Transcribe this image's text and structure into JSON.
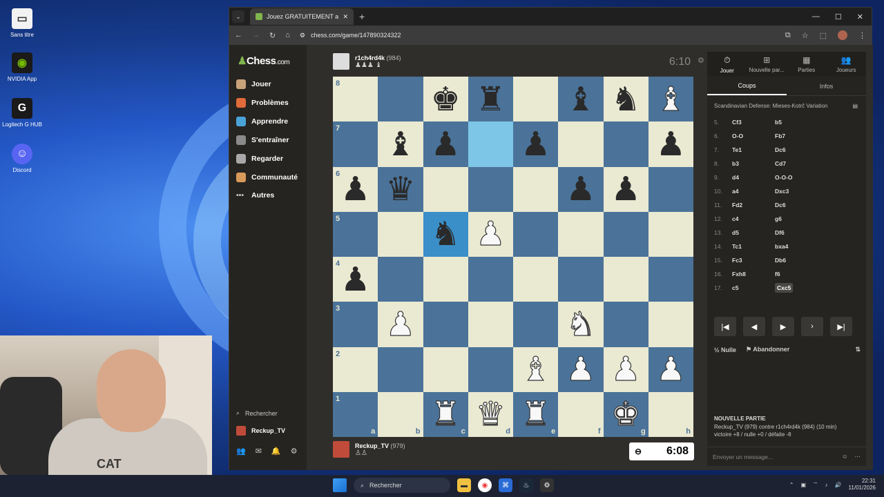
{
  "desktop": {
    "icons": [
      {
        "label": "Sans titre"
      },
      {
        "label": "NVIDIA App"
      },
      {
        "label": "Logitech G HUB"
      },
      {
        "label": "Discord"
      }
    ]
  },
  "browser": {
    "tab_title": "Jouez GRATUITEMENT aux éch",
    "url": "chess.com/game/147890324322"
  },
  "sidenav": {
    "logo": "Chess",
    "logo_suffix": ".com",
    "items": [
      {
        "label": "Jouer"
      },
      {
        "label": "Problèmes"
      },
      {
        "label": "Apprendre"
      },
      {
        "label": "S'entraîner"
      },
      {
        "label": "Regarder"
      },
      {
        "label": "Communauté"
      },
      {
        "label": "Autres"
      }
    ],
    "search": "Rechercher",
    "user": "Reckup_TV"
  },
  "game": {
    "top_player": {
      "name": "r1ch4rd4k",
      "rating": "(984)",
      "captured": "♟♟♟ ♝"
    },
    "top_clock": "6:10",
    "bottom_player": {
      "name": "Reckup_TV",
      "rating": "(979)",
      "captured": "♙♙"
    },
    "bottom_clock": "6:08",
    "board": [
      [
        "",
        "",
        "bK",
        "bR",
        "",
        "bB",
        "bN",
        "wB"
      ],
      [
        "",
        "bB",
        "bP",
        "",
        "bP",
        "",
        "",
        "bP"
      ],
      [
        "bP",
        "bQ",
        "",
        "",
        "",
        "bP",
        "bP",
        ""
      ],
      [
        "",
        "",
        "bN",
        "wP",
        "",
        "",
        "",
        ""
      ],
      [
        "bP",
        "",
        "",
        "",
        "",
        "",
        "",
        ""
      ],
      [
        "",
        "wP",
        "",
        "",
        "",
        "wN",
        "",
        ""
      ],
      [
        "",
        "",
        "",
        "",
        "wB",
        "wP",
        "wP",
        "wP"
      ],
      [
        "",
        "",
        "wR",
        "wQ",
        "wR",
        "",
        "wK",
        ""
      ]
    ],
    "highlight": [
      [
        1,
        3
      ],
      [
        3,
        2
      ]
    ],
    "ranks": [
      "8",
      "7",
      "6",
      "5",
      "4",
      "3",
      "2",
      "1"
    ],
    "files": [
      "a",
      "b",
      "c",
      "d",
      "e",
      "f",
      "g",
      "h"
    ]
  },
  "panel": {
    "tabs": [
      {
        "label": "Jouer",
        "icon": "timer-icon"
      },
      {
        "label": "Nouvelle par...",
        "icon": "plus-icon"
      },
      {
        "label": "Parties",
        "icon": "board-icon"
      },
      {
        "label": "Joueurs",
        "icon": "players-icon"
      }
    ],
    "subtabs": [
      "Coups",
      "Infos"
    ],
    "opening": "Scandinavian Defense: Mieses-Kotrč Variation",
    "moves": [
      {
        "n": "5.",
        "w": "Cf3",
        "b": "b5"
      },
      {
        "n": "6.",
        "w": "O-O",
        "b": "Fb7"
      },
      {
        "n": "7.",
        "w": "Te1",
        "b": "Dc6"
      },
      {
        "n": "8.",
        "w": "b3",
        "b": "Cd7"
      },
      {
        "n": "9.",
        "w": "d4",
        "b": "O-O-O"
      },
      {
        "n": "10.",
        "w": "a4",
        "b": "Dxc3"
      },
      {
        "n": "11.",
        "w": "Fd2",
        "b": "Dc6"
      },
      {
        "n": "12.",
        "w": "c4",
        "b": "g6"
      },
      {
        "n": "13.",
        "w": "d5",
        "b": "Df6"
      },
      {
        "n": "14.",
        "w": "Tc1",
        "b": "bxa4"
      },
      {
        "n": "15.",
        "w": "Fc3",
        "b": "Db6"
      },
      {
        "n": "16.",
        "w": "Fxh8",
        "b": "f6"
      },
      {
        "n": "17.",
        "w": "c5",
        "b": "Cxc5"
      }
    ],
    "draw": "Nulle",
    "resign": "Abandonner",
    "draw_prefix": "½",
    "new_game_title": "NOUVELLE PARTIE",
    "new_game_line1": "Reckup_TV (979) contre r1ch4rd4k (984) (10 min)",
    "new_game_line2": "victoire +8 / nulle +0 / défaite -8",
    "chat_placeholder": "Envoyer un message..."
  },
  "webcam": {
    "logo": "CAT"
  },
  "taskbar": {
    "search": "Rechercher",
    "time": "22:31",
    "date": "11/01/2026"
  }
}
